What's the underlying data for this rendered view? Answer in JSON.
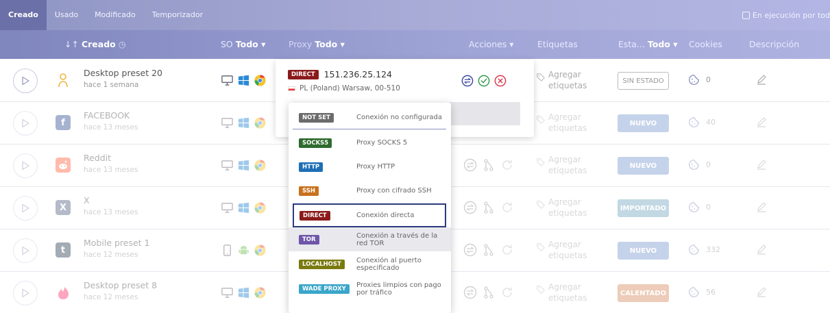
{
  "tabs": [
    "Creado",
    "Usado",
    "Modificado",
    "Temporizador"
  ],
  "run_all_label": "En ejecución por tod",
  "header": {
    "sort_arrow": "↓↑",
    "created": "Creado",
    "os": "SO",
    "os_filter": "Todo ▾",
    "proxy": "Proxy",
    "proxy_filter": "Todo ▾",
    "actions": "Acciones ▾",
    "tags": "Etiquetas",
    "status": "Esta...",
    "status_filter": "Todo ▾",
    "cookies": "Cookies",
    "description": "Descripción"
  },
  "rows": [
    {
      "name": "Desktop preset 20",
      "date": "hace 1 semana",
      "tag_line1": "Agregar",
      "tag_line2": "etiquetas",
      "status": "SIN ESTADO",
      "cookies": "0",
      "avatar": "",
      "avatar_color": "#f0b341"
    },
    {
      "name": "FACEBOOK",
      "date": "hace 13 meses",
      "tag_line1": "Agregar",
      "tag_line2": "etiquetas",
      "status": "NUEVO",
      "cookies": "40",
      "avatar": "f",
      "avatar_color": "#3b5998"
    },
    {
      "name": "Reddit",
      "date": "hace 13 meses",
      "tag_line1": "Agregar",
      "tag_line2": "etiquetas",
      "status": "NUEVO",
      "cookies": "0",
      "avatar": "",
      "avatar_color": "#ff4500"
    },
    {
      "name": "X",
      "date": "hace 13 meses",
      "tag_line1": "Agregar",
      "tag_line2": "etiquetas",
      "status": "IMPORTADO",
      "cookies": "0",
      "avatar": "X",
      "avatar_color": "#5a6785"
    },
    {
      "name": "Mobile preset 1",
      "date": "hace 12 meses",
      "tag_line1": "Agregar",
      "tag_line2": "etiquetas",
      "status": "NUEVO",
      "cookies": "332",
      "avatar": "t",
      "avatar_color": "#35465c"
    },
    {
      "name": "Desktop preset 8",
      "date": "hace 12 meses",
      "tag_line1": "Agregar",
      "tag_line2": "etiquetas",
      "status": "CALENTADO",
      "cookies": "56",
      "avatar": "",
      "avatar_color": "#fe3c72"
    }
  ],
  "proxy_card": {
    "type": "DIRECT",
    "ip": "151.236.25.124",
    "location": "PL (Poland) Warsaw, 00-510"
  },
  "proxy_options": [
    {
      "badge": "NOT SET",
      "label": "Conexión no configurada",
      "color": "#6b6b6b"
    },
    {
      "badge": "SOCKS5",
      "label": "Proxy SOCKS 5",
      "color": "#2e6b2e"
    },
    {
      "badge": "HTTP",
      "label": "Proxy HTTP",
      "color": "#1f6fb5"
    },
    {
      "badge": "SSH",
      "label": "Proxy con cifrado SSH",
      "color": "#c8711d"
    },
    {
      "badge": "DIRECT",
      "label": "Conexión directa",
      "color": "#8b1a1a"
    },
    {
      "badge": "TOR",
      "label": "Conexión a través de la red TOR",
      "color": "#6e56a8"
    },
    {
      "badge": "LOCALHOST",
      "label": "Conexión al puerto especificado",
      "color": "#7a7a10"
    },
    {
      "badge": "WADE PROXY",
      "label": "Proxies limpios con pago por tráfico",
      "color": "#3aa6c9"
    }
  ]
}
